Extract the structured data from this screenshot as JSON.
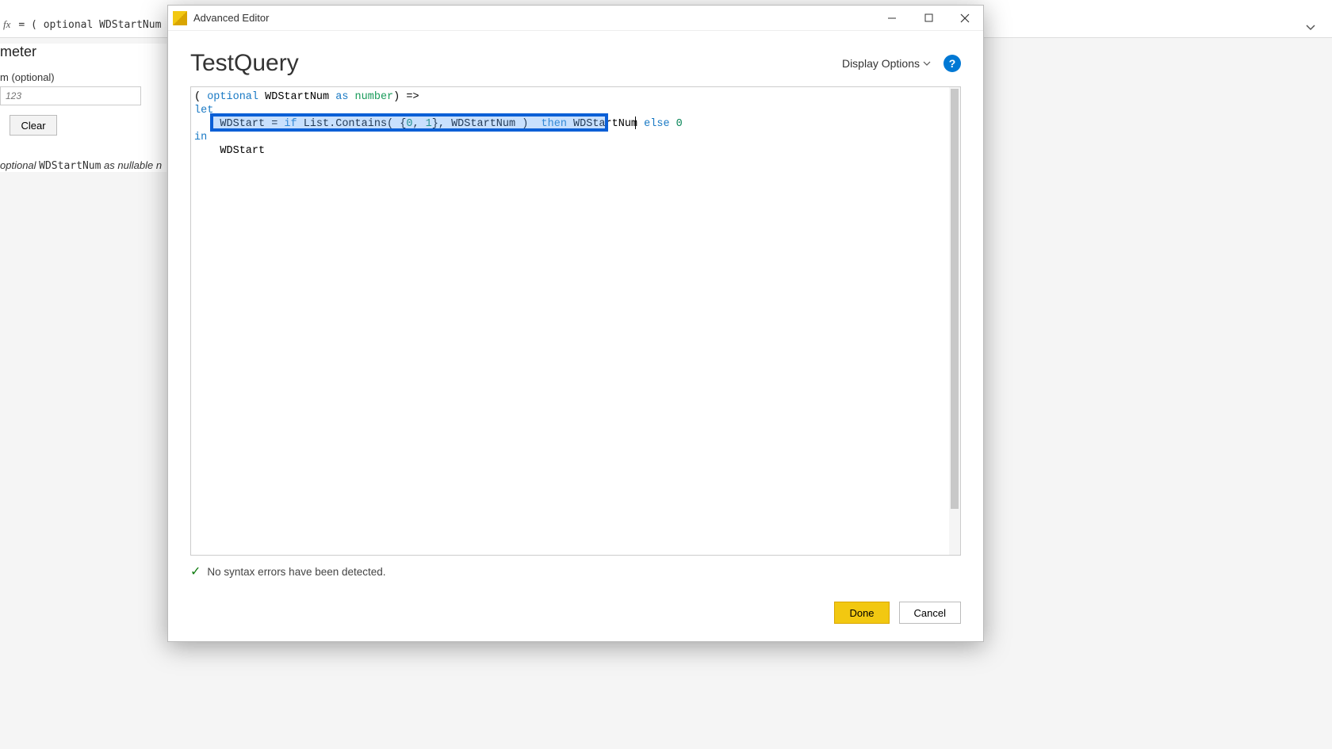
{
  "formulaBar": {
    "fxLabel": "fx",
    "formula": "= ( optional WDStartNum a"
  },
  "paramPanel": {
    "title": "meter",
    "fieldLabel": "m (optional)",
    "placeholder": "123",
    "clear": "Clear",
    "signaturePrefix": "optional ",
    "signatureMono": "WDStartNum",
    "signatureSuffix": " as nullable n"
  },
  "modal": {
    "title": "Advanced Editor",
    "queryName": "TestQuery",
    "displayOptions": "Display Options",
    "help": "?",
    "code": {
      "line1_pre": "( ",
      "line1_kw1": "optional",
      "line1_mid": " WDStartNum ",
      "line1_kw2": "as",
      "line1_sp": " ",
      "line1_ty": "number",
      "line1_post": ") =>",
      "line2": "let",
      "line3_a": "    WDStart = ",
      "line3_if": "if",
      "line3_b": " List.Contains( {",
      "line3_n0": "0",
      "line3_c": ", ",
      "line3_n1": "1",
      "line3_d": "}, WDStartNum )  ",
      "line3_then": "then",
      "line3_e": " WDStartNum ",
      "line3_else": "else",
      "line3_sp2": " ",
      "line3_n2": "0",
      "line4": "in",
      "line5": "    WDStart"
    },
    "status": "No syntax errors have been detected.",
    "done": "Done",
    "cancel": "Cancel"
  }
}
